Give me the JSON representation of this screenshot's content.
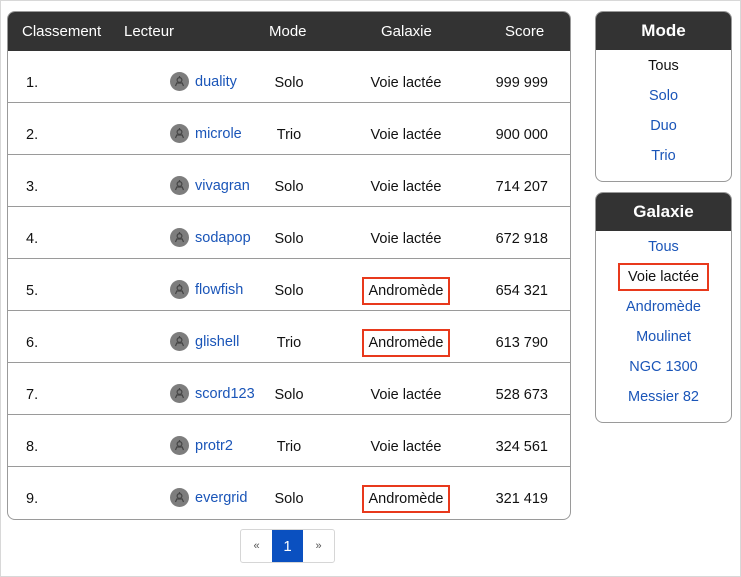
{
  "table": {
    "headers": [
      "Classement",
      "Lecteur",
      "Mode",
      "Galaxie",
      "Score"
    ],
    "rows": [
      {
        "rank": "1.",
        "player": "duality",
        "mode": "Solo",
        "galaxy": "Voie lactée",
        "score": "999 999",
        "highlight": false
      },
      {
        "rank": "2.",
        "player": "microle",
        "mode": "Trio",
        "galaxy": "Voie lactée",
        "score": "900 000",
        "highlight": false
      },
      {
        "rank": "3.",
        "player": "vivagran",
        "mode": "Solo",
        "galaxy": "Voie lactée",
        "score": "714 207",
        "highlight": false
      },
      {
        "rank": "4.",
        "player": "sodapop",
        "mode": "Solo",
        "galaxy": "Voie lactée",
        "score": "672 918",
        "highlight": false
      },
      {
        "rank": "5.",
        "player": "flowfish",
        "mode": "Solo",
        "galaxy": "Andromède",
        "score": "654 321",
        "highlight": true
      },
      {
        "rank": "6.",
        "player": "glishell",
        "mode": "Trio",
        "galaxy": "Andromède",
        "score": "613 790",
        "highlight": true
      },
      {
        "rank": "7.",
        "player": "scord123",
        "mode": "Solo",
        "galaxy": "Voie lactée",
        "score": "528 673",
        "highlight": false
      },
      {
        "rank": "8.",
        "player": "protr2",
        "mode": "Trio",
        "galaxy": "Voie lactée",
        "score": "324 561",
        "highlight": false
      },
      {
        "rank": "9.",
        "player": "evergrid",
        "mode": "Solo",
        "galaxy": "Andromède",
        "score": "321 419",
        "highlight": true
      }
    ],
    "avatar_icon": "robot-avatar-icon"
  },
  "pagination": {
    "prev": "«",
    "current": "1",
    "next": "»"
  },
  "mode_panel": {
    "title": "Mode",
    "items": [
      {
        "label": "Tous",
        "current": true,
        "highlight": false
      },
      {
        "label": "Solo",
        "current": false,
        "highlight": false
      },
      {
        "label": "Duo",
        "current": false,
        "highlight": false
      },
      {
        "label": "Trio",
        "current": false,
        "highlight": false
      }
    ]
  },
  "galaxy_panel": {
    "title": "Galaxie",
    "items": [
      {
        "label": "Tous",
        "current": false,
        "highlight": false
      },
      {
        "label": "Voie lactée",
        "current": true,
        "highlight": true
      },
      {
        "label": "Andromède",
        "current": false,
        "highlight": false
      },
      {
        "label": "Moulinet",
        "current": false,
        "highlight": false
      },
      {
        "label": "NGC 1300",
        "current": false,
        "highlight": false
      },
      {
        "label": "Messier 82",
        "current": false,
        "highlight": false
      }
    ]
  },
  "colors": {
    "header_bg": "#333333",
    "link": "#1a55b8",
    "highlight_border": "#e8391c",
    "pager_active": "#0a50c0"
  }
}
